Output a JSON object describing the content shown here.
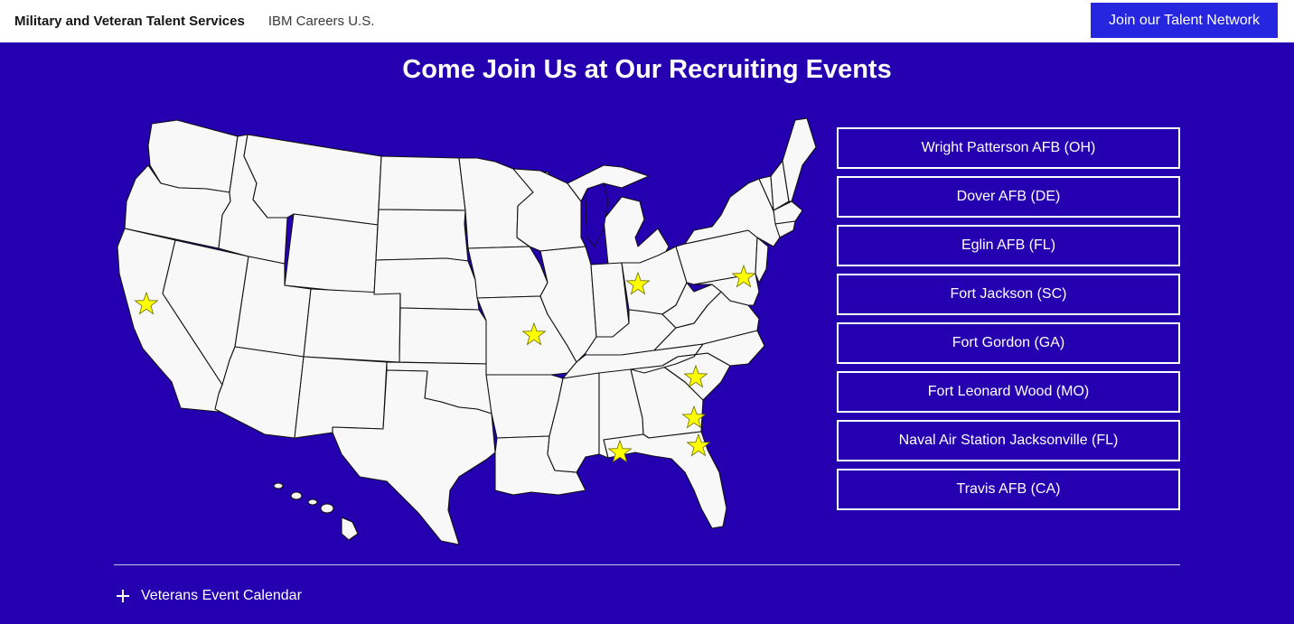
{
  "header": {
    "brand": "Military and Veteran Talent Services",
    "subbrand": "IBM Careers U.S.",
    "cta_label": "Join our Talent Network"
  },
  "main": {
    "title": "Come Join Us at Our Recruiting Events",
    "events": [
      {
        "label": "Wright Patterson AFB (OH)",
        "state": "OH"
      },
      {
        "label": "Dover AFB (DE)",
        "state": "DE"
      },
      {
        "label": "Eglin AFB (FL)",
        "state": "FL"
      },
      {
        "label": "Fort Jackson (SC)",
        "state": "SC"
      },
      {
        "label": "Fort Gordon (GA)",
        "state": "GA"
      },
      {
        "label": "Fort Leonard Wood (MO)",
        "state": "MO"
      },
      {
        "label": "Naval Air Station Jacksonville (FL)",
        "state": "FL"
      },
      {
        "label": "Travis AFB (CA)",
        "state": "CA"
      }
    ],
    "map": {
      "name": "United States map",
      "marker_color": "#ffff00",
      "land_color": "#f8f8f8",
      "water_color": "#2400b0"
    },
    "accordion_label": "Veterans Event Calendar"
  },
  "colors": {
    "background": "#2400b0",
    "cta": "#2626e0",
    "header_bg": "#ffffff"
  }
}
